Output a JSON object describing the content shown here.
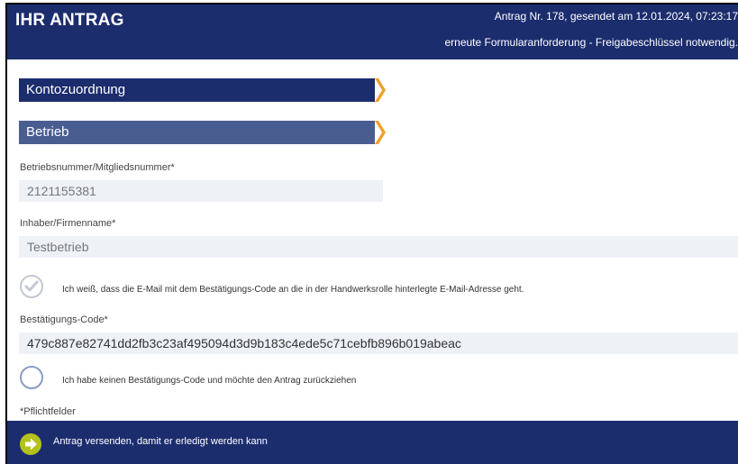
{
  "header": {
    "title": "IHR ANTRAG",
    "request_info": "Antrag Nr. 178, gesendet am 12.01.2024, 07:23:17",
    "status_info": "erneute Formularanforderung - Freigabeschlüssel notwendig."
  },
  "sections": {
    "konto": "Kontozuordnung",
    "betrieb": "Betrieb"
  },
  "fields": {
    "betriebsnummer_label": "Betriebsnummer/Mitgliedsnummer*",
    "betriebsnummer_value": "2121155381",
    "inhaber_label": "Inhaber/Firmenname*",
    "inhaber_value": "Testbetrieb",
    "email_consent_text": "Ich weiß, dass die E-Mail mit dem Bestätigungs-Code an die in der Handwerksrolle hinterlegte E-Mail-Adresse geht.",
    "code_label": "Bestätigungs-Code*",
    "code_value": "479c887e82741dd2fb3c23af495094d3d9b183c4ede5c71cebfb896b019abeac",
    "no_code_text": "Ich habe keinen Bestätigungs-Code und möchte den Antrag zurückziehen",
    "required_note": "*Pflichtfelder"
  },
  "footer": {
    "submit_label": "Antrag versenden, damit er erledigt werden kann"
  },
  "colors": {
    "primary": "#1c2d6e",
    "secondary": "#4a5d91",
    "accent_chevron": "#f0a030",
    "submit_icon": "#b3c21c"
  }
}
